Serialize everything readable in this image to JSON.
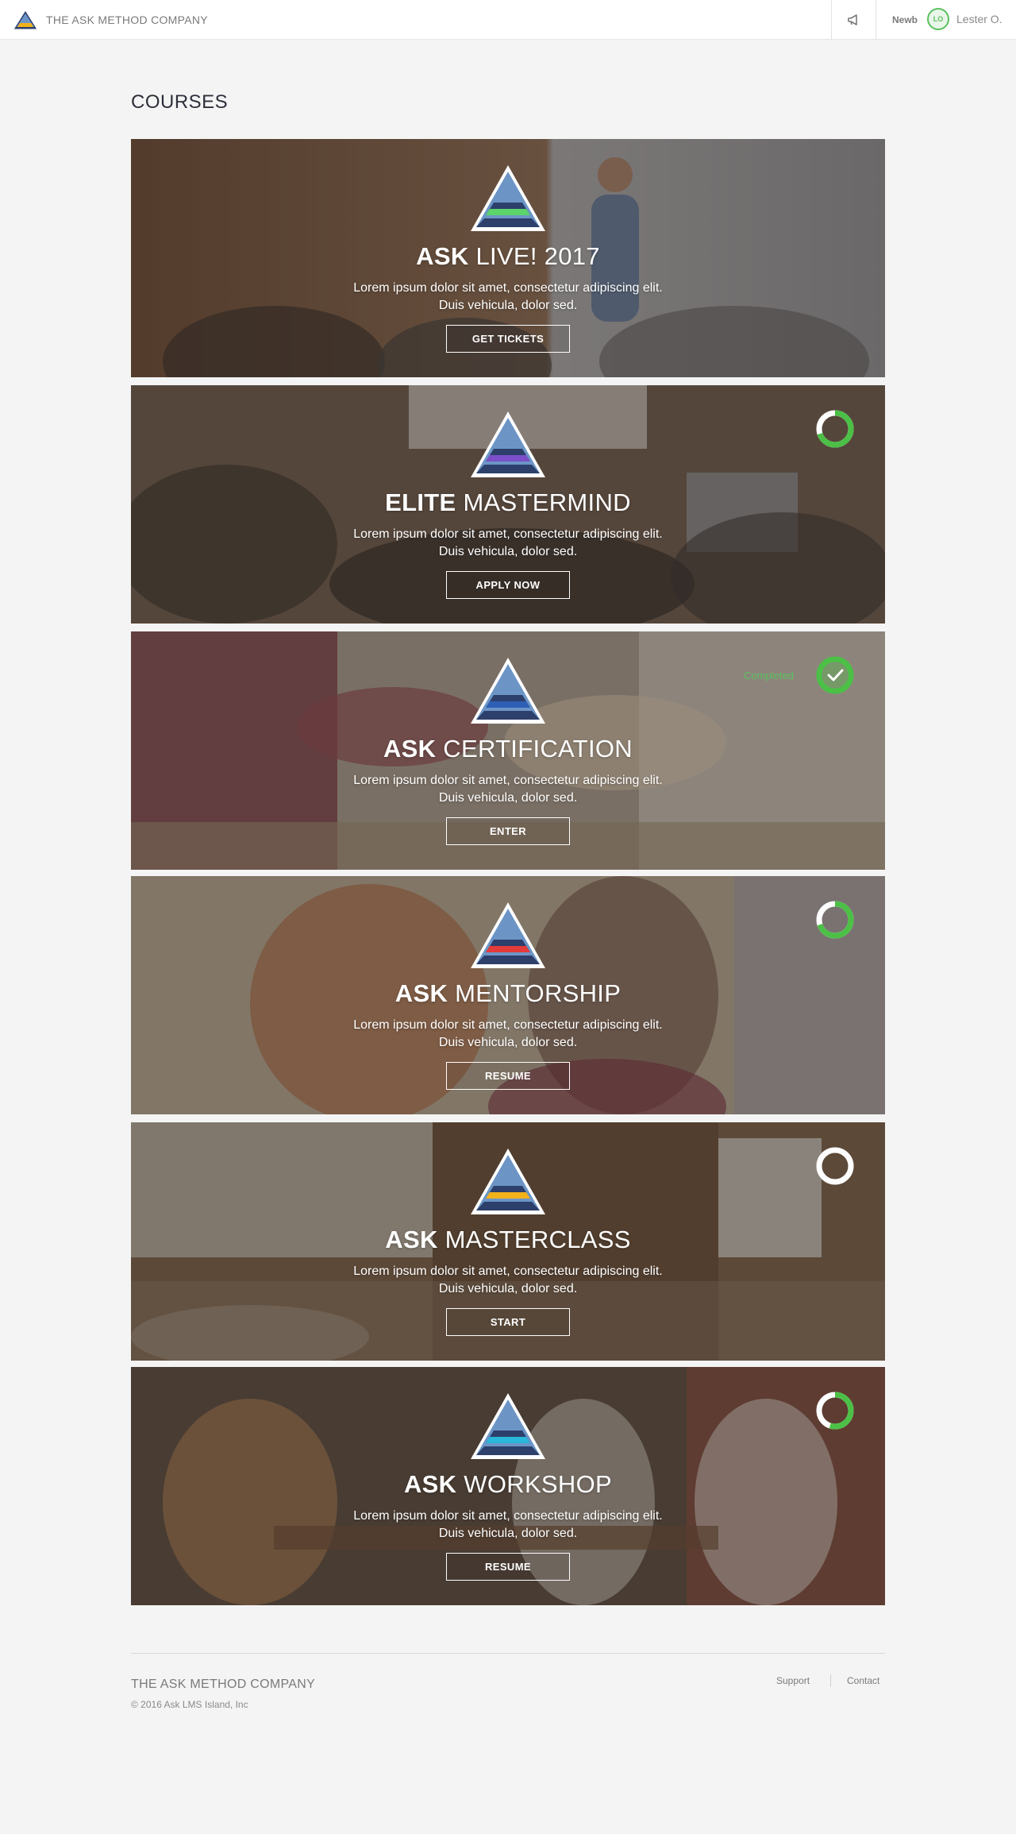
{
  "header": {
    "brand": "THE ASK METHOD COMPANY",
    "rank": "Newb",
    "avatar_initials": "LO",
    "username": "Lester O.",
    "accent_color": "#5cc15d"
  },
  "page": {
    "title": "COURSES"
  },
  "courses": [
    {
      "title_bold": "ASK",
      "title_rest": "LIVE! 2017",
      "description": "Lorem ipsum dolor sit amet, consectetur adipiscing elit. Duis vehicula, dolor sed.",
      "button": "GET TICKETS",
      "stripe_color": "#5bd46a",
      "progress": null,
      "status": ""
    },
    {
      "title_bold": "ELITE",
      "title_rest": "MASTERMIND",
      "description": "Lorem ipsum dolor sit amet, consectetur adipiscing elit. Duis vehicula, dolor sed.",
      "button": "APPLY NOW",
      "stripe_color": "#7b4fc9",
      "progress": 0.7,
      "status": ""
    },
    {
      "title_bold": "ASK",
      "title_rest": "CERTIFICATION",
      "description": "Lorem ipsum dolor sit amet, consectetur adipiscing elit. Duis vehicula, dolor sed.",
      "button": "ENTER",
      "stripe_color": "#2f5fb5",
      "progress": 1,
      "status": "Completed"
    },
    {
      "title_bold": "ASK",
      "title_rest": "MENTORSHIP",
      "description": "Lorem ipsum dolor sit amet, consectetur adipiscing elit. Duis vehicula, dolor sed.",
      "button": "RESUME",
      "stripe_color": "#e33b3b",
      "progress": 0.7,
      "status": ""
    },
    {
      "title_bold": "ASK",
      "title_rest": "MASTERCLASS",
      "description": "Lorem ipsum dolor sit amet, consectetur adipiscing elit. Duis vehicula, dolor sed.",
      "button": "START",
      "stripe_color": "#f2b21c",
      "progress": 0,
      "status": ""
    },
    {
      "title_bold": "ASK",
      "title_rest": "WORKSHOP",
      "description": "Lorem ipsum dolor sit amet, consectetur adipiscing elit. Duis vehicula, dolor sed.",
      "button": "RESUME",
      "stripe_color": "#2ab7d9",
      "progress": 0.55,
      "status": ""
    }
  ],
  "footer": {
    "brand": "THE ASK METHOD COMPANY",
    "copyright": "© 2016 Ask LMS Island, Inc",
    "links": [
      "Support",
      "Contact"
    ]
  }
}
